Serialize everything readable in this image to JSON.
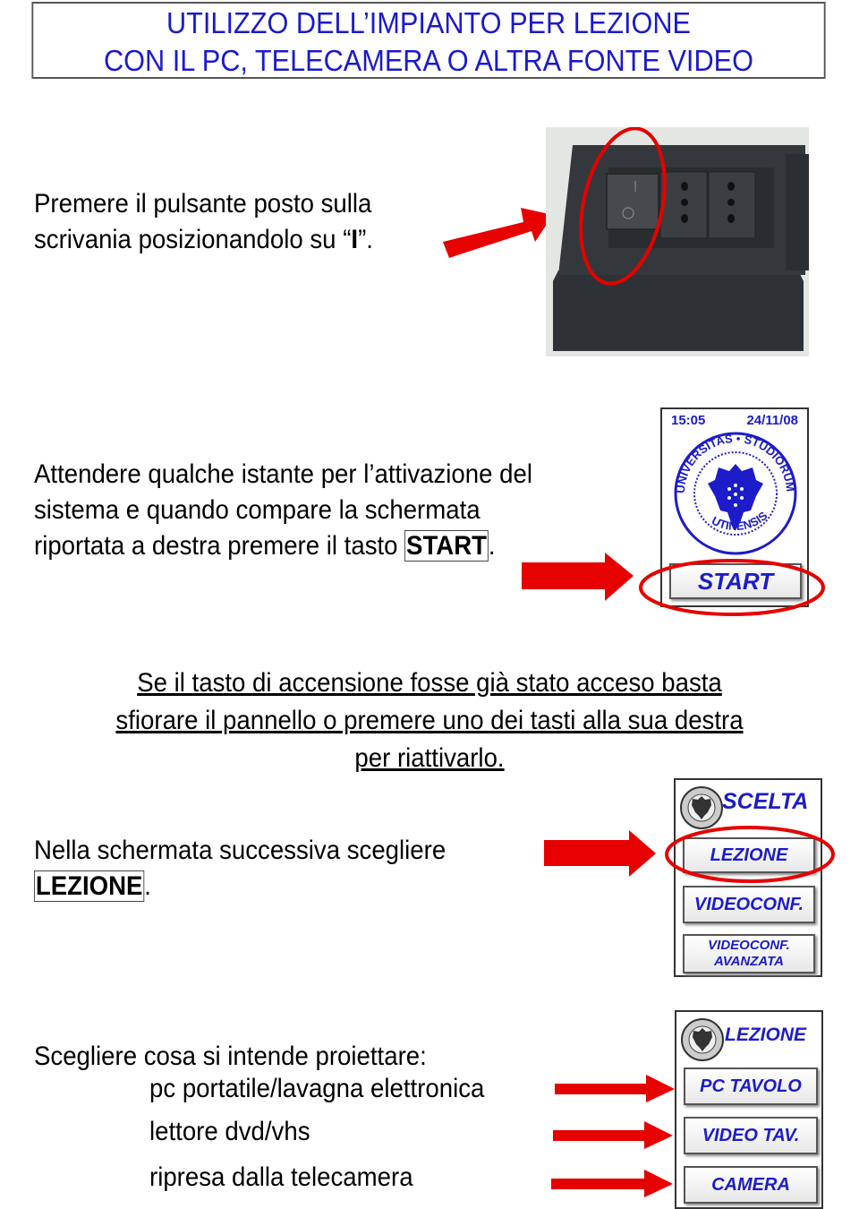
{
  "title": {
    "line1": "UTILIZZO DELL’IMPIANTO PER LEZIONE",
    "line2": "CON IL PC, TELECAMERA O ALTRA FONTE VIDEO"
  },
  "step1": {
    "line1": "Premere il pulsante posto sulla",
    "line2_prefix": "scrivania posizionandolo su “",
    "line2_key": "I",
    "line2_suffix": "”."
  },
  "step2": {
    "line1": "Attendere qualche istante per l’attivazione del",
    "line2": "sistema e quando compare la schermata",
    "line3_prefix": "riportata a destra premere il tasto ",
    "line3_key": "START",
    "line3_suffix": "."
  },
  "start_screen": {
    "time": "15:05",
    "date": "24/11/08",
    "seal_text_top": "UNIVERSITAS • STUDIORUM •",
    "seal_text_bottom": "UTINENSIS",
    "start_button": "START"
  },
  "note": {
    "line1": "Se il tasto di accensione fosse già stato acceso basta",
    "line2": "sfiorare il pannello o premere uno dei tasti alla sua destra",
    "line3": "per riattivarlo."
  },
  "step3": {
    "line1": "Nella schermata successiva scegliere",
    "line2_key": "LEZIONE",
    "line2_suffix": "."
  },
  "choice_screen": {
    "header": "SCELTA",
    "buttons": [
      "LEZIONE",
      "VIDEOCONF.",
      "VIDEOCONF.\nAVANZATA"
    ],
    "button_line1": "VIDEOCONF.",
    "button_line2": "AVANZATA"
  },
  "step4": {
    "intro": "Scegliere cosa si intende proiettare:",
    "options": [
      "pc portatile/lavagna elettronica",
      "lettore dvd/vhs",
      "ripresa dalla telecamera"
    ]
  },
  "lesson_screen": {
    "header": "LEZIONE",
    "buttons": [
      "PC TAVOLO",
      "VIDEO TAV.",
      "CAMERA"
    ]
  },
  "colors": {
    "title_blue": "#1a1acc",
    "button_blue": "#1c1cc9",
    "highlight_red": "#e60000"
  }
}
